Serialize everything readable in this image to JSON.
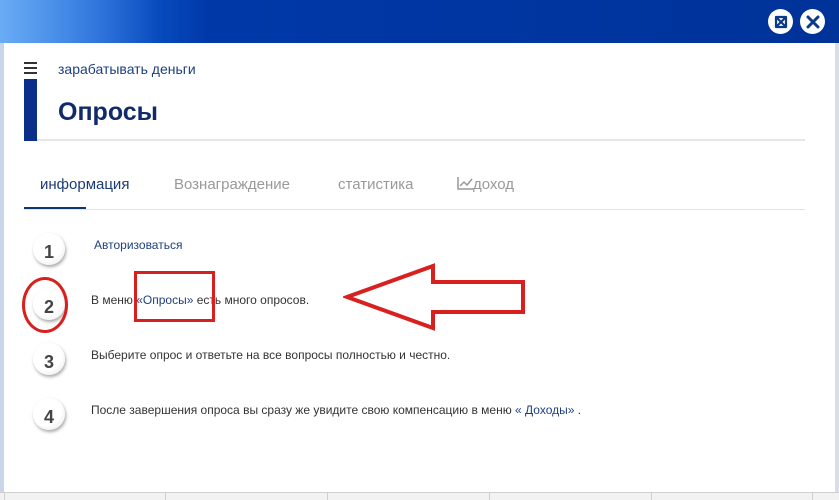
{
  "window": {
    "maximize_icon": "expand-arrows-icon",
    "close_icon": "close-x-icon"
  },
  "header": {
    "breadcrumb": "зарабатывать деньги",
    "title": "Опросы"
  },
  "tabs": [
    {
      "label": "информация",
      "active": true
    },
    {
      "label": "Вознаграждение",
      "active": false
    },
    {
      "label": "статистика",
      "active": false
    },
    {
      "label": "доход",
      "icon": "line-chart-icon",
      "active": false
    }
  ],
  "steps": [
    {
      "number": "1",
      "link": "Авторизоваться"
    },
    {
      "number": "2",
      "before": "В меню ",
      "link": "«Опросы»",
      "after": " есть много опросов."
    },
    {
      "number": "3",
      "text": "Выберите опрос и ответьте на все вопросы полностью и честно."
    },
    {
      "number": "4",
      "before": "После завершения опроса вы сразу же увидите свою компенсацию в меню ",
      "link": "« Доходы»",
      "after": " ."
    }
  ],
  "colors": {
    "accent": "#0a2e8a",
    "annotation_red": "#d8201f",
    "titlebar": "#003399"
  }
}
